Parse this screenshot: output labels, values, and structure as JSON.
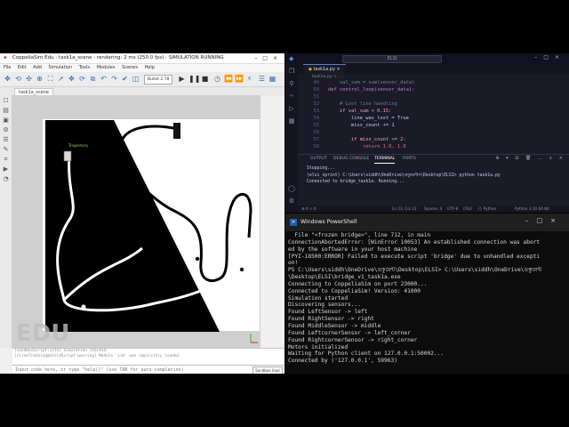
{
  "coppelia": {
    "title": "CoppeliaSim Edu - task1a_scene - rendering: 2 ms (250.0 fps) - SIMULATION RUNNING",
    "menu": [
      "File",
      "Edit",
      "Add",
      "Simulation",
      "Tools",
      "Modules",
      "Scenes",
      "Help"
    ],
    "engine": "Bullet 2.78",
    "scene_tab": "task1a_scene",
    "trajectory_label": "Trajectory",
    "watermark": "EDU",
    "console_lines": [
      "[sandboxScript:info] Simulation started.",
      "[/LineTracking@childScript:warning] Module 'sim' was implicitly loaded."
    ],
    "command_placeholder": "Input code here, or type \"help()\" (use TAB for auto-completion)",
    "sandbox_select": "Sandbox (lua)"
  },
  "vscode": {
    "search": "ELSI",
    "tab_label": "task1a.py",
    "breadcrumb": "task1a.py > ...",
    "line_numbers": [
      "49",
      "50",
      "51",
      "52",
      "53",
      "54",
      "55",
      "56",
      "57",
      "58"
    ],
    "code_lines": [
      "    val_sum = sum(sensor_data)",
      "def control_loop(sensor_data):",
      "",
      "    # Lost line handling",
      "    if val_sum < 0.15:",
      "        line_was_lost = True",
      "        miss_count += 1",
      "",
      "        if miss_count <= 2:",
      "            return 1.0, 1.0"
    ],
    "panel_tabs": [
      "OUTPUT",
      "DEBUG CONSOLE",
      "TERMINAL",
      "PORTS"
    ],
    "terminal_lines": [
      "Stopping...",
      "",
      "(elsi_sprint) C:\\Users\\siddh\\OneDrive\\ডকুমেন্টস\\Desktop\\ELSI> python task1a.py",
      "Connected to bridge_task1a. Running..."
    ],
    "status": {
      "left": "⊗ 0 ⚠ 0",
      "position": "Ln 23, Col 22",
      "spaces": "Spaces: 4",
      "encoding": "UTF-8",
      "eol": "CRLF",
      "language": "{} Python",
      "interpreter": "Python 3.10 64-bit"
    }
  },
  "powershell": {
    "title": "Windows PowerShell",
    "lines": [
      "  File \"<frozen bridge>\", line 712, in main",
      "ConnectionAbortedError: [WinError 10053] An established connection was abort",
      "ed by the software in your host machine",
      "[PYI-18500:ERROR] Failed to execute script 'bridge' due to unhandled excepti",
      "on!",
      "PS C:\\Users\\siddh\\OneDrive\\ডকুমেন্ট\\Desktop\\ELSI> C:\\Users\\siddh\\OneDrive\\ডকুমেন্ট",
      "\\Desktop\\ELSI\\bridge_v1_task1a.exe",
      "Connecting to CoppeliaSim on port 23000...",
      "Connected to CoppeliaSim! Version: 41000",
      "Simulation started",
      "Discovering sensors...",
      "Found LeftSensor -> left",
      "Found RightSensor -> right",
      "Found MiddleSensor -> middle",
      "Found LeftcornerSensor -> left_corner",
      "Found RightcornerSensor -> right_corner",
      "Motors initialized",
      "Waiting for Python client on 127.0.0.1:50002...",
      "Connected by ('127.0.0.1', 59963)"
    ]
  },
  "colors": {
    "vscode_bg": "#1b1b28",
    "terminal_bg": "#0c0c0c",
    "accent": "#5a7bd6"
  }
}
